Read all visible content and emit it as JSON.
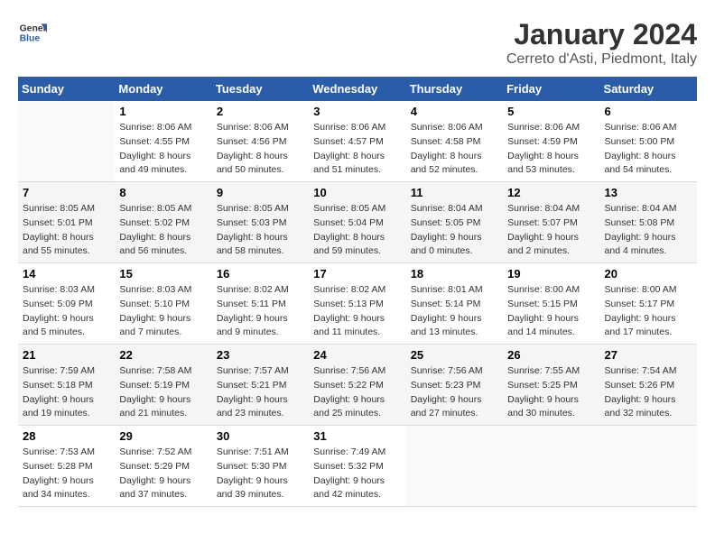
{
  "logo": {
    "text_general": "General",
    "text_blue": "Blue"
  },
  "header": {
    "month_year": "January 2024",
    "location": "Cerreto d'Asti, Piedmont, Italy"
  },
  "weekdays": [
    "Sunday",
    "Monday",
    "Tuesday",
    "Wednesday",
    "Thursday",
    "Friday",
    "Saturday"
  ],
  "weeks": [
    [
      {
        "day": "",
        "sunrise": "",
        "sunset": "",
        "daylight": ""
      },
      {
        "day": "1",
        "sunrise": "Sunrise: 8:06 AM",
        "sunset": "Sunset: 4:55 PM",
        "daylight": "Daylight: 8 hours and 49 minutes."
      },
      {
        "day": "2",
        "sunrise": "Sunrise: 8:06 AM",
        "sunset": "Sunset: 4:56 PM",
        "daylight": "Daylight: 8 hours and 50 minutes."
      },
      {
        "day": "3",
        "sunrise": "Sunrise: 8:06 AM",
        "sunset": "Sunset: 4:57 PM",
        "daylight": "Daylight: 8 hours and 51 minutes."
      },
      {
        "day": "4",
        "sunrise": "Sunrise: 8:06 AM",
        "sunset": "Sunset: 4:58 PM",
        "daylight": "Daylight: 8 hours and 52 minutes."
      },
      {
        "day": "5",
        "sunrise": "Sunrise: 8:06 AM",
        "sunset": "Sunset: 4:59 PM",
        "daylight": "Daylight: 8 hours and 53 minutes."
      },
      {
        "day": "6",
        "sunrise": "Sunrise: 8:06 AM",
        "sunset": "Sunset: 5:00 PM",
        "daylight": "Daylight: 8 hours and 54 minutes."
      }
    ],
    [
      {
        "day": "7",
        "sunrise": "Sunrise: 8:05 AM",
        "sunset": "Sunset: 5:01 PM",
        "daylight": "Daylight: 8 hours and 55 minutes."
      },
      {
        "day": "8",
        "sunrise": "Sunrise: 8:05 AM",
        "sunset": "Sunset: 5:02 PM",
        "daylight": "Daylight: 8 hours and 56 minutes."
      },
      {
        "day": "9",
        "sunrise": "Sunrise: 8:05 AM",
        "sunset": "Sunset: 5:03 PM",
        "daylight": "Daylight: 8 hours and 58 minutes."
      },
      {
        "day": "10",
        "sunrise": "Sunrise: 8:05 AM",
        "sunset": "Sunset: 5:04 PM",
        "daylight": "Daylight: 8 hours and 59 minutes."
      },
      {
        "day": "11",
        "sunrise": "Sunrise: 8:04 AM",
        "sunset": "Sunset: 5:05 PM",
        "daylight": "Daylight: 9 hours and 0 minutes."
      },
      {
        "day": "12",
        "sunrise": "Sunrise: 8:04 AM",
        "sunset": "Sunset: 5:07 PM",
        "daylight": "Daylight: 9 hours and 2 minutes."
      },
      {
        "day": "13",
        "sunrise": "Sunrise: 8:04 AM",
        "sunset": "Sunset: 5:08 PM",
        "daylight": "Daylight: 9 hours and 4 minutes."
      }
    ],
    [
      {
        "day": "14",
        "sunrise": "Sunrise: 8:03 AM",
        "sunset": "Sunset: 5:09 PM",
        "daylight": "Daylight: 9 hours and 5 minutes."
      },
      {
        "day": "15",
        "sunrise": "Sunrise: 8:03 AM",
        "sunset": "Sunset: 5:10 PM",
        "daylight": "Daylight: 9 hours and 7 minutes."
      },
      {
        "day": "16",
        "sunrise": "Sunrise: 8:02 AM",
        "sunset": "Sunset: 5:11 PM",
        "daylight": "Daylight: 9 hours and 9 minutes."
      },
      {
        "day": "17",
        "sunrise": "Sunrise: 8:02 AM",
        "sunset": "Sunset: 5:13 PM",
        "daylight": "Daylight: 9 hours and 11 minutes."
      },
      {
        "day": "18",
        "sunrise": "Sunrise: 8:01 AM",
        "sunset": "Sunset: 5:14 PM",
        "daylight": "Daylight: 9 hours and 13 minutes."
      },
      {
        "day": "19",
        "sunrise": "Sunrise: 8:00 AM",
        "sunset": "Sunset: 5:15 PM",
        "daylight": "Daylight: 9 hours and 14 minutes."
      },
      {
        "day": "20",
        "sunrise": "Sunrise: 8:00 AM",
        "sunset": "Sunset: 5:17 PM",
        "daylight": "Daylight: 9 hours and 17 minutes."
      }
    ],
    [
      {
        "day": "21",
        "sunrise": "Sunrise: 7:59 AM",
        "sunset": "Sunset: 5:18 PM",
        "daylight": "Daylight: 9 hours and 19 minutes."
      },
      {
        "day": "22",
        "sunrise": "Sunrise: 7:58 AM",
        "sunset": "Sunset: 5:19 PM",
        "daylight": "Daylight: 9 hours and 21 minutes."
      },
      {
        "day": "23",
        "sunrise": "Sunrise: 7:57 AM",
        "sunset": "Sunset: 5:21 PM",
        "daylight": "Daylight: 9 hours and 23 minutes."
      },
      {
        "day": "24",
        "sunrise": "Sunrise: 7:56 AM",
        "sunset": "Sunset: 5:22 PM",
        "daylight": "Daylight: 9 hours and 25 minutes."
      },
      {
        "day": "25",
        "sunrise": "Sunrise: 7:56 AM",
        "sunset": "Sunset: 5:23 PM",
        "daylight": "Daylight: 9 hours and 27 minutes."
      },
      {
        "day": "26",
        "sunrise": "Sunrise: 7:55 AM",
        "sunset": "Sunset: 5:25 PM",
        "daylight": "Daylight: 9 hours and 30 minutes."
      },
      {
        "day": "27",
        "sunrise": "Sunrise: 7:54 AM",
        "sunset": "Sunset: 5:26 PM",
        "daylight": "Daylight: 9 hours and 32 minutes."
      }
    ],
    [
      {
        "day": "28",
        "sunrise": "Sunrise: 7:53 AM",
        "sunset": "Sunset: 5:28 PM",
        "daylight": "Daylight: 9 hours and 34 minutes."
      },
      {
        "day": "29",
        "sunrise": "Sunrise: 7:52 AM",
        "sunset": "Sunset: 5:29 PM",
        "daylight": "Daylight: 9 hours and 37 minutes."
      },
      {
        "day": "30",
        "sunrise": "Sunrise: 7:51 AM",
        "sunset": "Sunset: 5:30 PM",
        "daylight": "Daylight: 9 hours and 39 minutes."
      },
      {
        "day": "31",
        "sunrise": "Sunrise: 7:49 AM",
        "sunset": "Sunset: 5:32 PM",
        "daylight": "Daylight: 9 hours and 42 minutes."
      },
      {
        "day": "",
        "sunrise": "",
        "sunset": "",
        "daylight": ""
      },
      {
        "day": "",
        "sunrise": "",
        "sunset": "",
        "daylight": ""
      },
      {
        "day": "",
        "sunrise": "",
        "sunset": "",
        "daylight": ""
      }
    ]
  ]
}
